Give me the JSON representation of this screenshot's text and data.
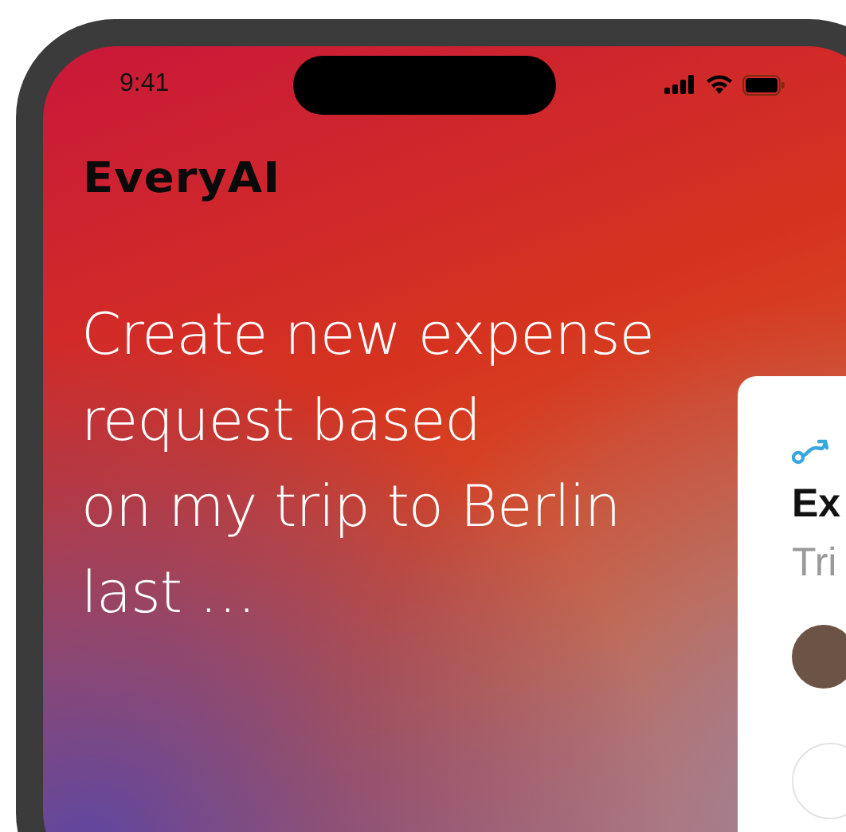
{
  "status_bar": {
    "time": "9:41"
  },
  "brand": {
    "logo": "EveryAI"
  },
  "prompt": {
    "lines": [
      "Create new expense",
      "request based",
      "on my trip to Berlin",
      "last …"
    ]
  },
  "card": {
    "title": "Ex",
    "subtitle": "Tri"
  }
}
